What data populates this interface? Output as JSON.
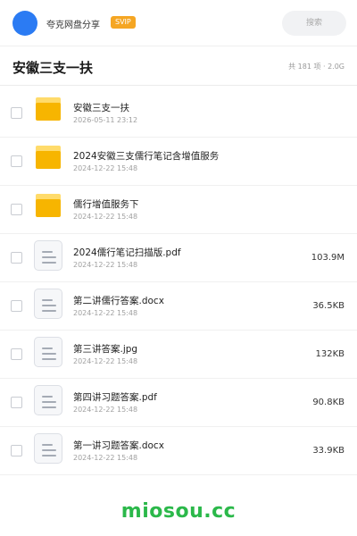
{
  "header": {
    "share_label": "夸克网盘分享",
    "badge": "SVIP",
    "search_placeholder": "搜索"
  },
  "folder": {
    "title": "安徽三支一扶",
    "meta": "共 181 项 · 2.0G"
  },
  "files": [
    {
      "name": "安徽三支一扶",
      "date": "2026-05-11 23:12",
      "size": "",
      "type": "folder"
    },
    {
      "name": "2024安徽三支儒行笔记含增值服务",
      "date": "2024-12-22 15:48",
      "size": "",
      "type": "folder"
    },
    {
      "name": "儒行增值服务下",
      "date": "2024-12-22 15:48",
      "size": "",
      "type": "folder"
    },
    {
      "name": "2024儒行笔记扫描版.pdf",
      "date": "2024-12-22 15:48",
      "size": "103.9M",
      "type": "doc"
    },
    {
      "name": "第二讲儒行答案.docx",
      "date": "2024-12-22 15:48",
      "size": "36.5KB",
      "type": "doc"
    },
    {
      "name": "第三讲答案.jpg",
      "date": "2024-12-22 15:48",
      "size": "132KB",
      "type": "doc"
    },
    {
      "name": "第四讲习题答案.pdf",
      "date": "2024-12-22 15:48",
      "size": "90.8KB",
      "type": "doc"
    },
    {
      "name": "第一讲习题答案.docx",
      "date": "2024-12-22 15:48",
      "size": "33.9KB",
      "type": "doc"
    }
  ],
  "watermark": "miosou.cc",
  "colors": {
    "avatar": "#2b7bf3",
    "badge": "#f5a623",
    "folder": "#f7b500",
    "watermark": "#2bb84a"
  }
}
